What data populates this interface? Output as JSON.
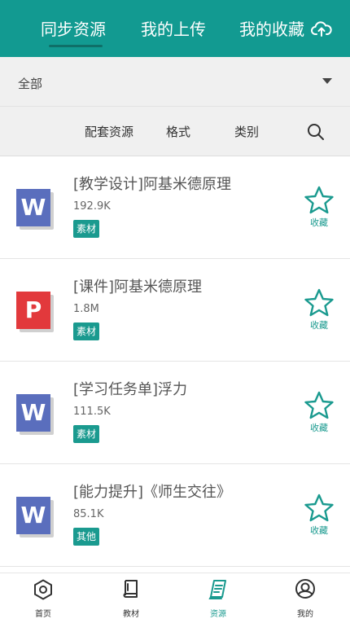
{
  "colors": {
    "brand": "#129a91",
    "accent": "#1a9a8f",
    "word": "#5a6ebd",
    "ppt": "#e2393c"
  },
  "top_tabs": [
    {
      "label": "同步资源",
      "active": true
    },
    {
      "label": "我的上传",
      "active": false
    },
    {
      "label": "我的收藏",
      "active": false
    }
  ],
  "filter": {
    "value": "全部"
  },
  "sort_options": [
    "配套资源",
    "格式",
    "类别"
  ],
  "fav_label": "收藏",
  "resources": [
    {
      "type_letter": "W",
      "title": "[教学设计]阿基米德原理",
      "size": "192.9K",
      "tag": "素材"
    },
    {
      "type_letter": "P",
      "title": "[课件]阿基米德原理",
      "size": "1.8M",
      "tag": "素材"
    },
    {
      "type_letter": "W",
      "title": "[学习任务单]浮力",
      "size": "111.5K",
      "tag": "素材"
    },
    {
      "type_letter": "W",
      "title": "[能力提升]《师生交往》",
      "size": "85.1K",
      "tag": "其他"
    }
  ],
  "bottom_nav": [
    {
      "label": "首页",
      "icon": "hexagon-home-icon",
      "active": false
    },
    {
      "label": "教材",
      "icon": "book-icon",
      "active": false
    },
    {
      "label": "资源",
      "icon": "resource-book-icon",
      "active": true
    },
    {
      "label": "我的",
      "icon": "user-icon",
      "active": false
    }
  ]
}
